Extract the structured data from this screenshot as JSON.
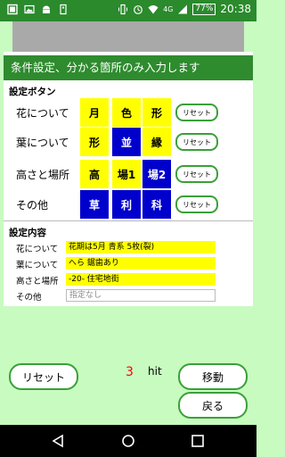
{
  "status_bar": {
    "battery": "77%",
    "time": "20:38",
    "network": "4G"
  },
  "panel": {
    "title": "条件設定、分かる箇所のみ入力します",
    "settings_header": "設定ボタン",
    "rows": [
      {
        "label": "花について",
        "buttons": [
          {
            "text": "月",
            "state": "off"
          },
          {
            "text": "色",
            "state": "off"
          },
          {
            "text": "形",
            "state": "off"
          }
        ],
        "reset": "リセット"
      },
      {
        "label": "葉について",
        "buttons": [
          {
            "text": "形",
            "state": "off"
          },
          {
            "text": "並",
            "state": "on"
          },
          {
            "text": "縁",
            "state": "off"
          }
        ],
        "reset": "リセット"
      },
      {
        "label": "高さと場所",
        "buttons": [
          {
            "text": "高",
            "state": "off"
          },
          {
            "text": "場1",
            "state": "off"
          },
          {
            "text": "場2",
            "state": "on"
          }
        ],
        "reset": "リセット"
      },
      {
        "label": "その他",
        "buttons": [
          {
            "text": "草",
            "state": "on"
          },
          {
            "text": "利",
            "state": "on"
          },
          {
            "text": "科",
            "state": "on"
          }
        ],
        "reset": "リセット"
      }
    ],
    "content_header": "設定内容",
    "content": [
      {
        "label": "花について",
        "value": "花期は5月 青系 5枚(裂)"
      },
      {
        "label": "葉について",
        "value": "へら 鋸歯あり"
      },
      {
        "label": "高さと場所",
        "value": "-20- 住宅地街"
      },
      {
        "label": "その他",
        "placeholder": "指定なし"
      }
    ]
  },
  "bottom": {
    "reset_label": "リセット",
    "hit_count": "3",
    "hit_unit": "hit",
    "move_label": "移動",
    "back_label": "戻る"
  },
  "colors": {
    "status_bar": "#2a8a2c",
    "accent": "#2e8b2e",
    "button_off": "#ffff00",
    "button_on": "#0000cc",
    "background": "#c8fbc0"
  }
}
